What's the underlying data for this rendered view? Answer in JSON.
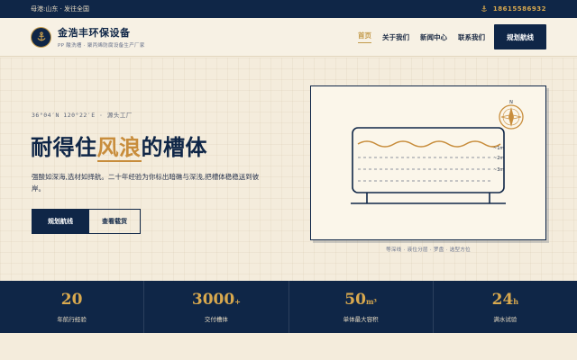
{
  "topbar": {
    "location": "母港:山东 · 发往全国",
    "phone": "18615586932",
    "phone_icon": "anchor-icon"
  },
  "header": {
    "brand_name": "金浩丰环保设备",
    "brand_tag": "PP 酸洗槽 · 聚丙烯防腐设备生产厂家",
    "logo_icon": "anchor-icon",
    "nav": [
      "首页",
      "关于我们",
      "新闻中心",
      "联系我们"
    ],
    "active_nav": "首页",
    "cta": "规划航线"
  },
  "hero": {
    "coords": "36°04′N 120°22′E · 源头工厂",
    "headline_pre": "耐得住",
    "headline_highlight": "风浪",
    "headline_post": "的槽体",
    "subtext": "强酸如深海,选材如择航。二十年经验为你标出暗礁与深浅,把槽体稳稳送到彼岸。",
    "primary_button": "规划航线",
    "secondary_button": "查看载货"
  },
  "illustration": {
    "caption": "等深线 · 液位分层 · 罗盘 · 选型方位",
    "compass_label": "N",
    "levels": [
      "~1m",
      "~2m",
      "~3m"
    ]
  },
  "stats": [
    {
      "value": "20",
      "unit": "",
      "label": "年航行经验"
    },
    {
      "value": "3000",
      "unit": "+",
      "label": "交付槽体"
    },
    {
      "value": "50",
      "unit": "m³",
      "label": "单体最大容积"
    },
    {
      "value": "24",
      "unit": "h",
      "label": "满水试验"
    }
  ],
  "colors": {
    "navy": "#0f2647",
    "gold": "#c39a4a",
    "cream": "#f4ecdc"
  }
}
